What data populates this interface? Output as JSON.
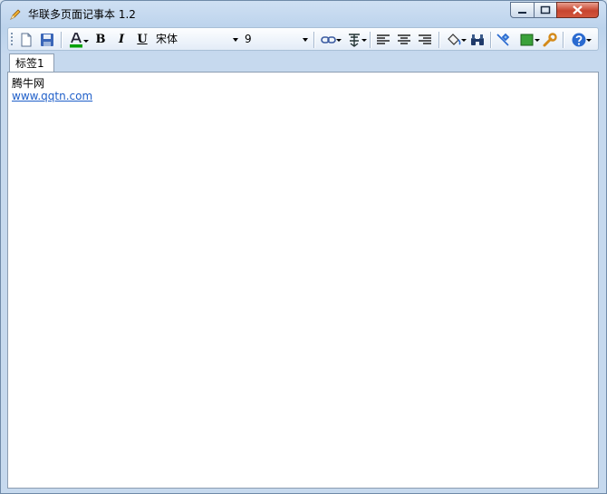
{
  "window": {
    "title": "华联多页面记事本 1.2"
  },
  "toolbar": {
    "bold_label": "B",
    "italic_label": "I",
    "underline_label": "U",
    "font_family": "宋体",
    "font_size": "9"
  },
  "tabs": [
    {
      "label": "标签1"
    }
  ],
  "editor": {
    "line1": "腾牛网",
    "line2": "www.qqtn.com"
  },
  "colors": {
    "font_color_bar": "#00a000",
    "link": "#1f5fc9"
  }
}
